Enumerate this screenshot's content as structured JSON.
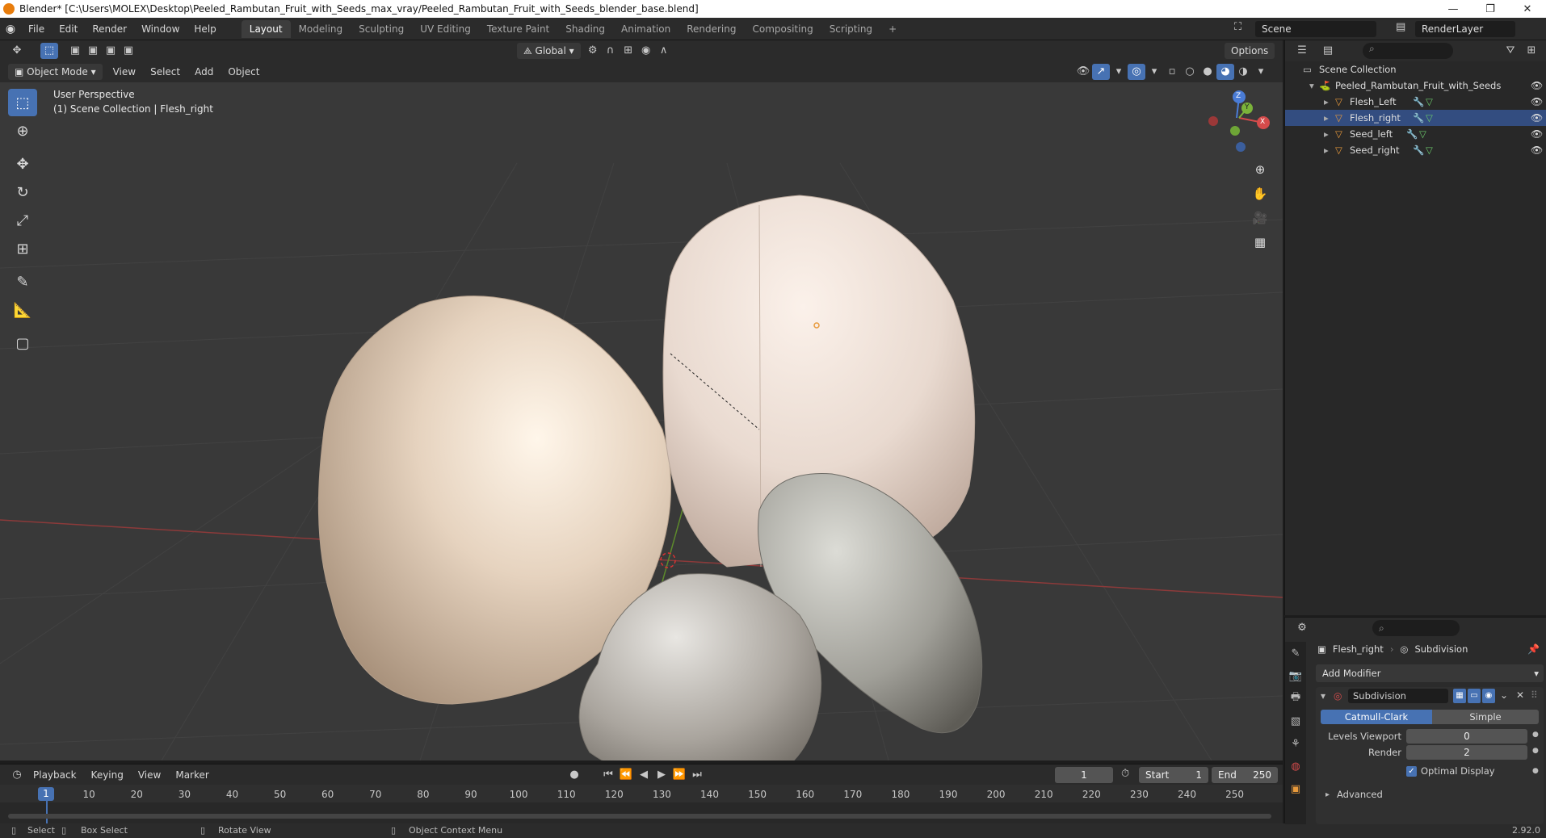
{
  "window": {
    "title": "Blender* [C:\\Users\\MOLEX\\Desktop\\Peeled_Rambutan_Fruit_with_Seeds_max_vray/Peeled_Rambutan_Fruit_with_Seeds_blender_base.blend]",
    "minimize": "—",
    "maximize": "❐",
    "close": "✕"
  },
  "menu": [
    "File",
    "Edit",
    "Render",
    "Window",
    "Help"
  ],
  "workspaces": [
    "Layout",
    "Modeling",
    "Sculpting",
    "UV Editing",
    "Texture Paint",
    "Shading",
    "Animation",
    "Rendering",
    "Compositing",
    "Scripting"
  ],
  "workspace_add": "+",
  "scene": {
    "name": "Scene",
    "render_layer": "RenderLayer"
  },
  "vp_toolbar": {
    "orientation": "Global",
    "options": "Options"
  },
  "vp_header": {
    "mode": "Object Mode",
    "menus": [
      "View",
      "Select",
      "Add",
      "Object"
    ]
  },
  "viewport": {
    "perspective": "User Perspective",
    "collection_info": "(1) Scene Collection | Flesh_right",
    "gizmo": {
      "z": "Z",
      "y": "Y",
      "x": "X"
    }
  },
  "timeline": {
    "menus": [
      "Playback",
      "Keying",
      "View",
      "Marker"
    ],
    "current_frame": "1",
    "start_label": "Start",
    "start": "1",
    "end_label": "End",
    "end": "250",
    "frame_marker": "1",
    "ticks": [
      "10",
      "20",
      "30",
      "40",
      "50",
      "60",
      "70",
      "80",
      "90",
      "100",
      "110",
      "120",
      "130",
      "140",
      "150",
      "160",
      "170",
      "180",
      "190",
      "200",
      "210",
      "220",
      "230",
      "240",
      "250"
    ]
  },
  "statusbar": {
    "select": "Select",
    "box_select": "Box Select",
    "rotate": "Rotate View",
    "context": "Object Context Menu",
    "version": "2.92.0"
  },
  "outliner": {
    "root": "Scene Collection",
    "collection": "Peeled_Rambutan_Fruit_with_Seeds",
    "objects": [
      "Flesh_Left",
      "Flesh_right",
      "Seed_left",
      "Seed_right"
    ]
  },
  "properties": {
    "object": "Flesh_right",
    "modifier_crumb": "Subdivision",
    "add_modifier": "Add Modifier",
    "modifier_name": "Subdivision",
    "catmull": "Catmull-Clark",
    "simple": "Simple",
    "levels_viewport_label": "Levels Viewport",
    "levels_viewport": "0",
    "render_label": "Render",
    "render": "2",
    "optimal_display": "Optimal Display",
    "advanced": "Advanced"
  },
  "colors": {
    "accent": "#4772b3",
    "viewport_bg": "#393939",
    "panel_bg": "#2b2b2b"
  }
}
